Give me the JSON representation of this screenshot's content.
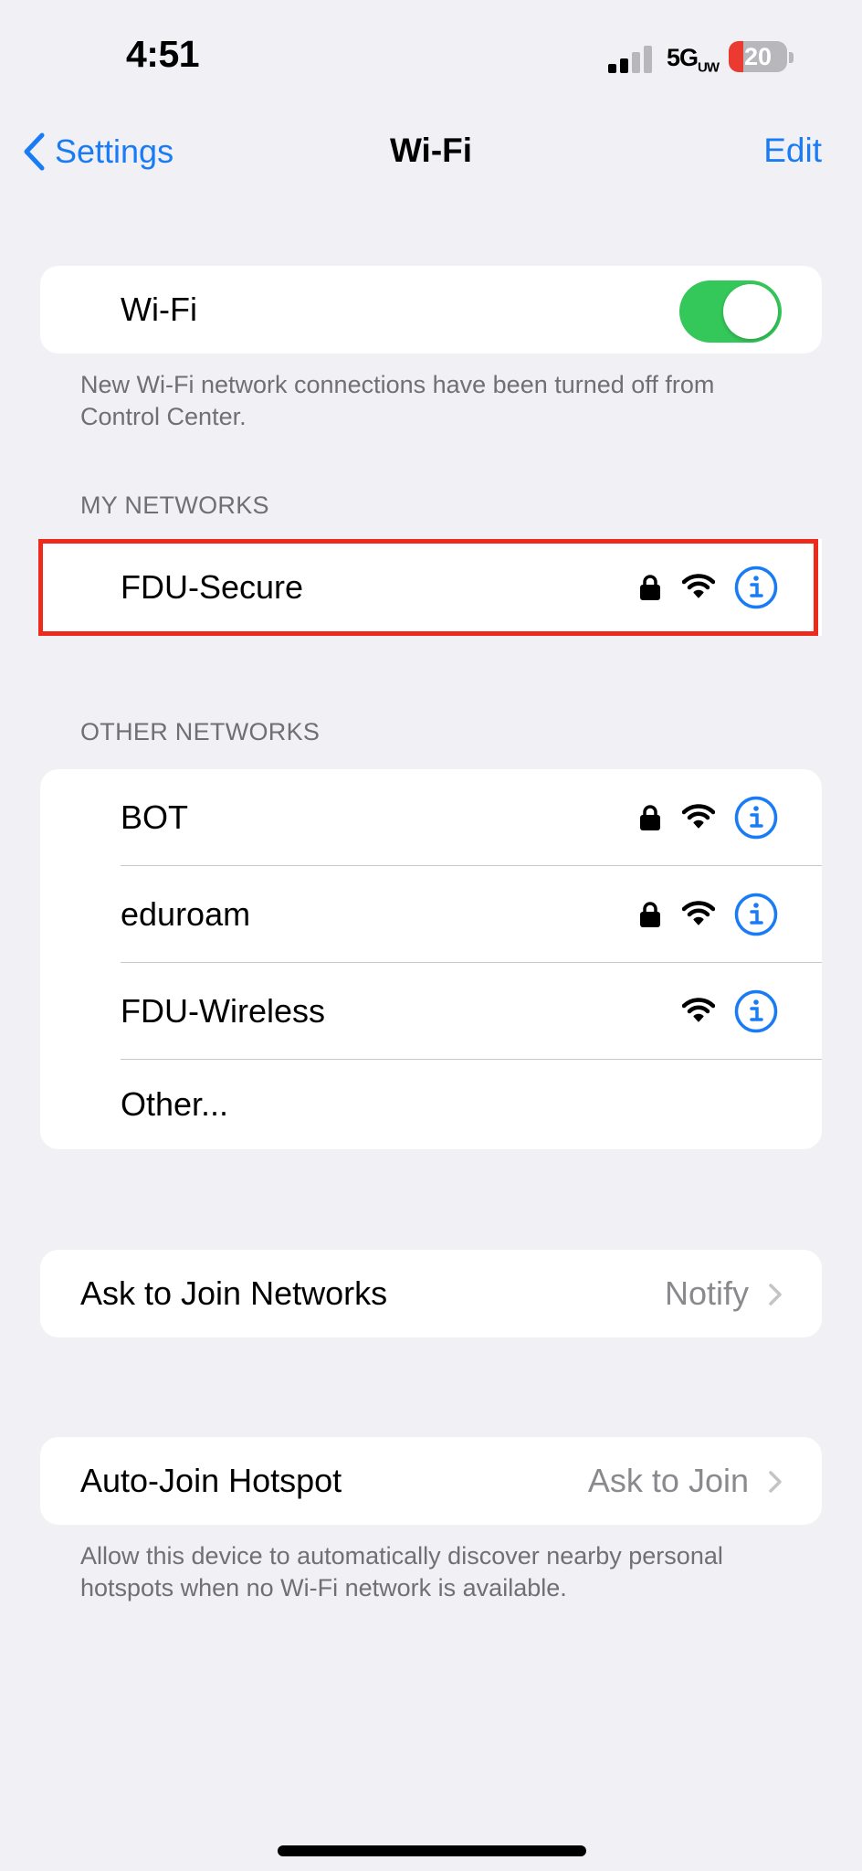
{
  "status": {
    "time": "4:51",
    "network": "5G",
    "network_suffix": "UW",
    "battery": "20"
  },
  "nav": {
    "back_label": "Settings",
    "title": "Wi-Fi",
    "edit_label": "Edit"
  },
  "wifi_toggle": {
    "label": "Wi-Fi",
    "on": true,
    "footer": "New Wi-Fi network connections have been turned off from Control Center."
  },
  "my_networks": {
    "header": "MY NETWORKS",
    "items": [
      {
        "name": "FDU-Secure",
        "locked": true
      }
    ]
  },
  "other_networks": {
    "header": "OTHER NETWORKS",
    "items": [
      {
        "name": "BOT",
        "locked": true
      },
      {
        "name": "eduroam",
        "locked": true
      },
      {
        "name": "FDU-Wireless",
        "locked": false
      }
    ],
    "other_label": "Other..."
  },
  "ask_to_join": {
    "label": "Ask to Join Networks",
    "value": "Notify"
  },
  "auto_join": {
    "label": "Auto-Join Hotspot",
    "value": "Ask to Join",
    "footer": "Allow this device to automatically discover nearby personal hotspots when no Wi-Fi network is available."
  },
  "colors": {
    "accent": "#1a7cf5",
    "toggle_on": "#34c759",
    "highlight": "#ee2a1c"
  }
}
